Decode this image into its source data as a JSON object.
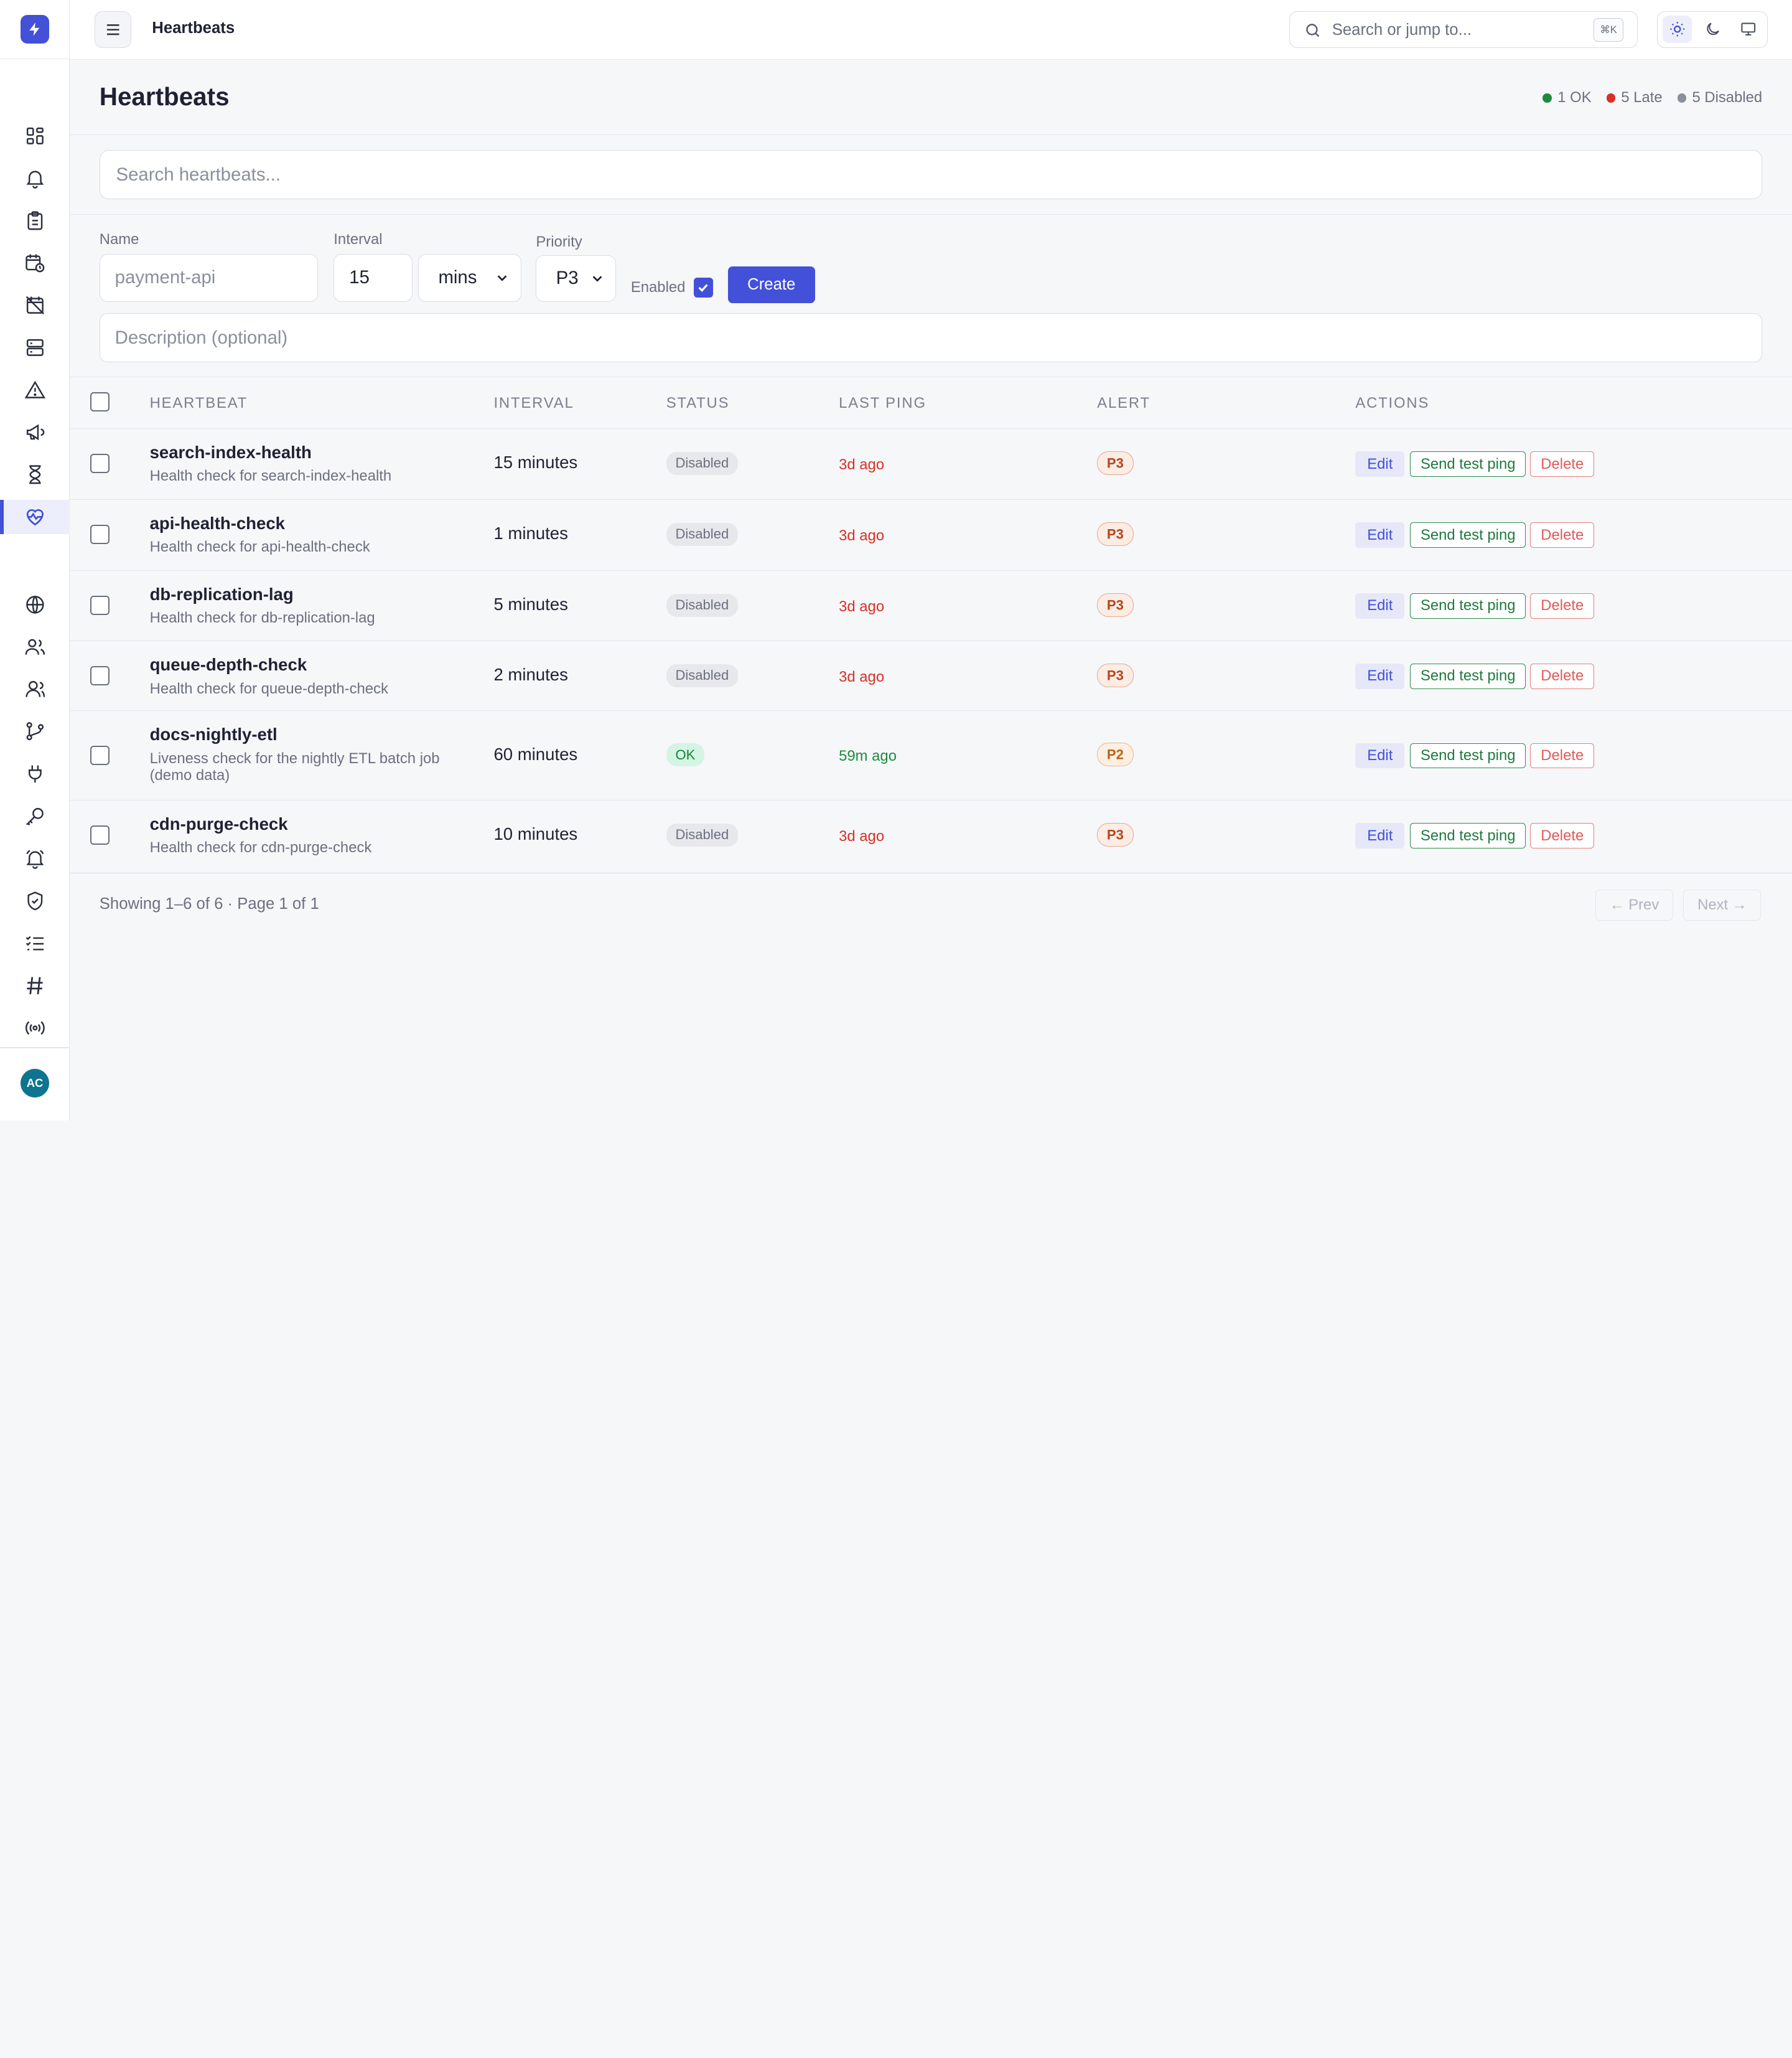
{
  "app": {
    "avatar_initials": "AC",
    "accent": "#4350d8"
  },
  "topbar": {
    "title": "Heartbeats",
    "search_placeholder": "Search or jump to...",
    "shortcut": "⌘K"
  },
  "page": {
    "title": "Heartbeats"
  },
  "summary": [
    {
      "label": "1 OK",
      "color": "#1f8a3f"
    },
    {
      "label": "5 Late",
      "color": "#d93025"
    },
    {
      "label": "5 Disabled",
      "color": "#8a8f9c"
    }
  ],
  "search": {
    "placeholder": "Search heartbeats..."
  },
  "form": {
    "name_label": "Name",
    "name_placeholder": "payment-api",
    "interval_label": "Interval",
    "interval_value": "15",
    "unit_value": "mins",
    "priority_label": "Priority",
    "priority_value": "P3",
    "enabled_label": "Enabled",
    "enabled": true,
    "create_label": "Create",
    "description_placeholder": "Description (optional)"
  },
  "table": {
    "columns": [
      "HEARTBEAT",
      "INTERVAL",
      "STATUS",
      "LAST PING",
      "ALERT",
      "ACTIONS"
    ],
    "action_labels": {
      "edit": "Edit",
      "test": "Send test ping",
      "delete": "Delete"
    },
    "rows": [
      {
        "name": "search-index-health",
        "desc": "Health check for search-index-health",
        "interval": "15 minutes",
        "status": "Disabled",
        "last_ping": "3d ago",
        "alert": "P3"
      },
      {
        "name": "api-health-check",
        "desc": "Health check for api-health-check",
        "interval": "1 minutes",
        "status": "Disabled",
        "last_ping": "3d ago",
        "alert": "P3"
      },
      {
        "name": "db-replication-lag",
        "desc": "Health check for db-replication-lag",
        "interval": "5 minutes",
        "status": "Disabled",
        "last_ping": "3d ago",
        "alert": "P3"
      },
      {
        "name": "queue-depth-check",
        "desc": "Health check for queue-depth-check",
        "interval": "2 minutes",
        "status": "Disabled",
        "last_ping": "3d ago",
        "alert": "P3"
      },
      {
        "name": "docs-nightly-etl",
        "desc": "Liveness check for the nightly ETL batch job (demo data)",
        "interval": "60 minutes",
        "status": "OK",
        "last_ping": "59m ago",
        "alert": "P2"
      },
      {
        "name": "cdn-purge-check",
        "desc": "Health check for cdn-purge-check",
        "interval": "10 minutes",
        "status": "Disabled",
        "last_ping": "3d ago",
        "alert": "P3"
      }
    ]
  },
  "footer": {
    "info": "Showing 1–6 of 6 · Page 1 of 1",
    "prev": "← Prev",
    "next": "Next →"
  },
  "nav_icons": [
    "dashboard-icon",
    "bell-icon",
    "clipboard-icon",
    "calendar-clock-icon",
    "calendar-off-icon",
    "server-icon",
    "warning-icon",
    "megaphone-icon",
    "hourglass-icon",
    "heartbeat-icon",
    "globe-icon",
    "users-icon",
    "team-icon",
    "git-branch-icon",
    "plug-icon",
    "key-icon",
    "alarm-icon",
    "shield-icon",
    "checklist-icon",
    "hash-icon",
    "broadcast-icon"
  ]
}
